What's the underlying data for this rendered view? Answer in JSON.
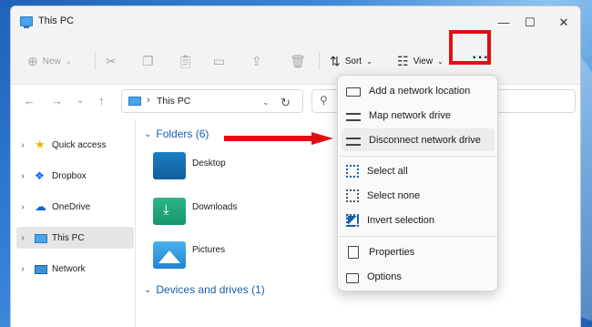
{
  "window": {
    "title": "This PC",
    "controls": {
      "minimize": "—",
      "maximize": "☐",
      "close": "✕"
    }
  },
  "toolbar": {
    "new_label": "New",
    "sort_label": "Sort",
    "view_label": "View",
    "more_label": "···"
  },
  "address": {
    "path": "This PC"
  },
  "sidebar": {
    "items": [
      {
        "label": "Quick access"
      },
      {
        "label": "Dropbox"
      },
      {
        "label": "OneDrive"
      },
      {
        "label": "This PC"
      },
      {
        "label": "Network"
      }
    ]
  },
  "main": {
    "folders_header": "Folders (6)",
    "folders": [
      {
        "label": "Desktop"
      },
      {
        "label": "Downloads"
      },
      {
        "label": "Pictures"
      }
    ],
    "devices_header": "Devices and drives (1)"
  },
  "menu": {
    "items": [
      {
        "label": "Add a network location"
      },
      {
        "label": "Map network drive"
      },
      {
        "label": "Disconnect network drive"
      },
      {
        "label": "Select all"
      },
      {
        "label": "Select none"
      },
      {
        "label": "Invert selection"
      },
      {
        "label": "Properties"
      },
      {
        "label": "Options"
      }
    ]
  },
  "colors": {
    "highlight_red": "#e10f13",
    "accent_blue": "#1a5ea8"
  }
}
